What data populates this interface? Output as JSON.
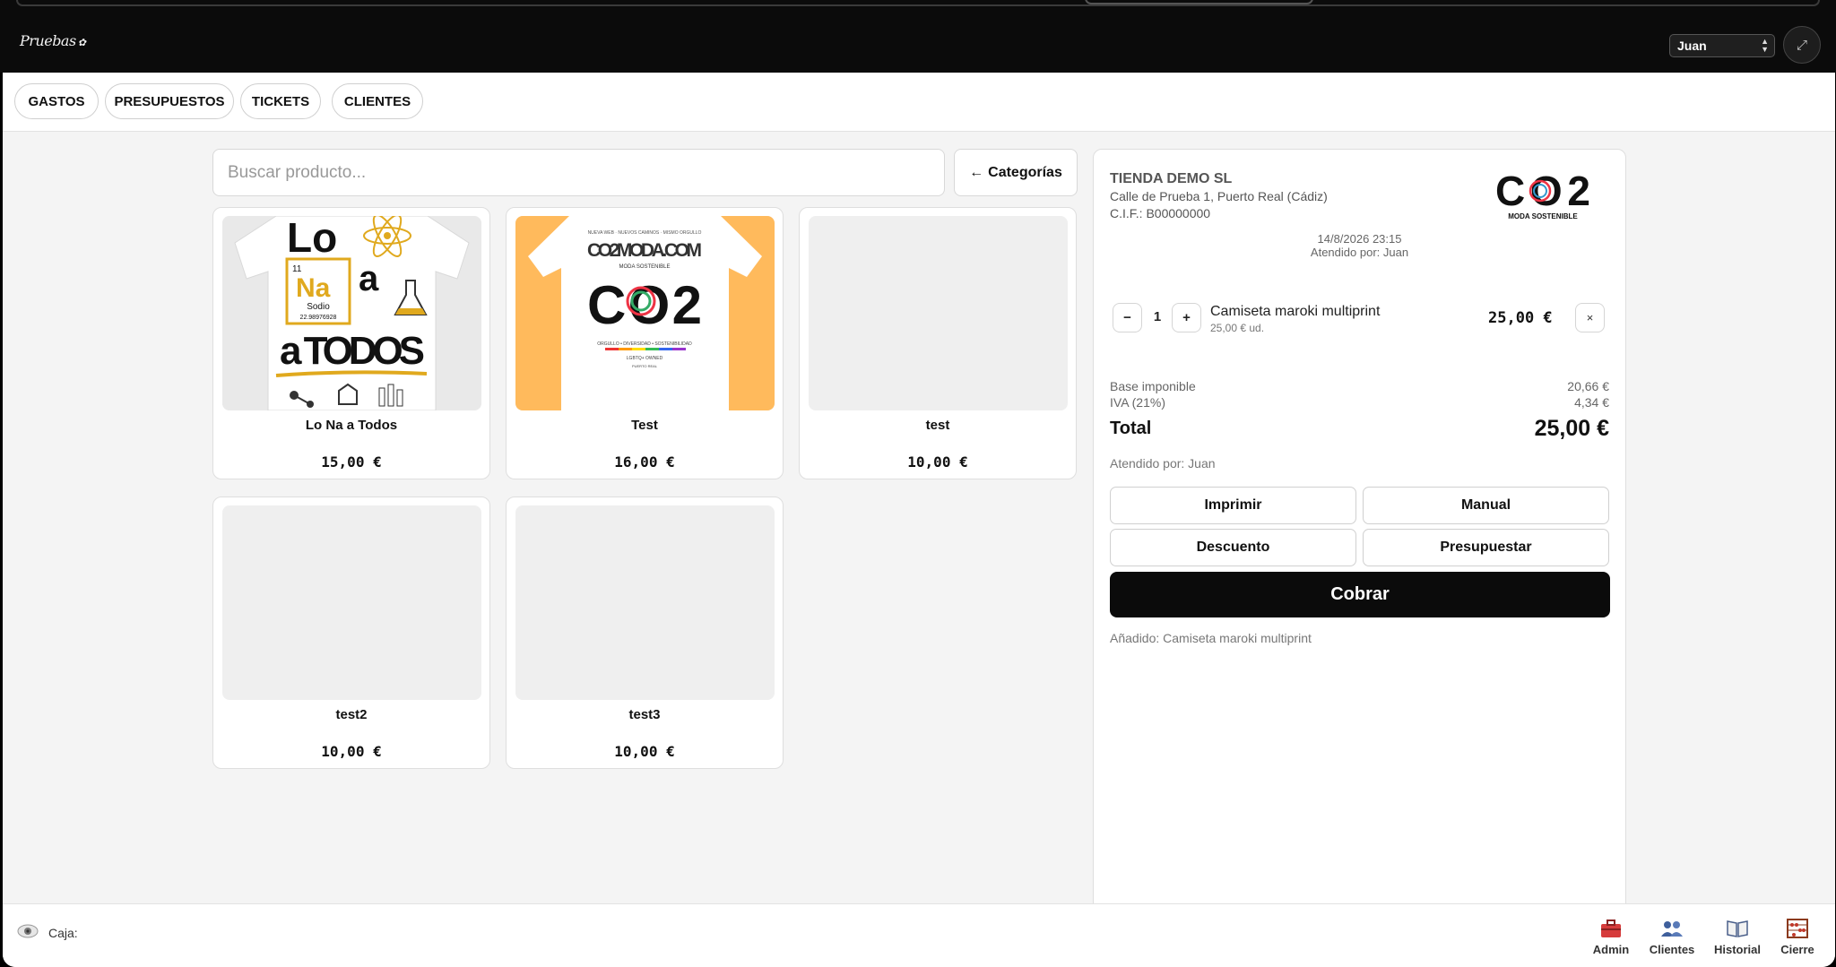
{
  "header": {
    "logo_text": "Pruebas",
    "user_selected": "Juan"
  },
  "nav": [
    "GASTOS",
    "PRESUPUESTOS",
    "TICKETS",
    "CLIENTES"
  ],
  "search": {
    "placeholder": "Buscar producto..."
  },
  "categories_button": {
    "arrow": "←",
    "label": "Categorías"
  },
  "products": [
    {
      "name": "Lo Na a Todos",
      "price": "15,00 €",
      "art": {
        "line1": "Lo",
        "element_number": "11",
        "symbol": "Na",
        "element_name": "Sodio",
        "element_mass": "22.98976928",
        "line2": "a",
        "line3": "a TODOS"
      }
    },
    {
      "name": "Test",
      "price": "16,00 €",
      "art": {
        "top_small": "NUEVA WEB · NUEVOS CAMINOS · MISMO ORGULLO",
        "site": "CO2MODA.COM",
        "sub": "MODA SOSTENIBLE",
        "big": "CO2",
        "bottom": "ORGULLO • DIVERSIDAD • SOSTENIBILIDAD",
        "bottom2": "LGBTQ+ OWNED",
        "place": "PUERTO REAL"
      }
    },
    {
      "name": "test",
      "price": "10,00 €"
    },
    {
      "name": "test2",
      "price": "10,00 €"
    },
    {
      "name": "test3",
      "price": "10,00 €"
    }
  ],
  "ticket": {
    "store_name": "TIENDA DEMO SL",
    "address": "Calle de Prueba 1, Puerto Real (Cádiz)",
    "cif": "C.I.F.: B00000000",
    "logo_big": "CO2",
    "logo_sub": "MODA SOSTENIBLE",
    "datetime": "14/8/2026 23:15",
    "attended": "Atendido por: Juan",
    "line": {
      "qty": "1",
      "minus": "−",
      "plus": "+",
      "name": "Camiseta maroki multiprint",
      "unit": "25,00 € ud.",
      "price": "25,00 €",
      "remove": "×"
    },
    "base_label": "Base imponible",
    "base_value": "20,66 €",
    "iva_label": "IVA (21%)",
    "iva_value": "4,34 €",
    "total_label": "Total",
    "total_value": "25,00 €",
    "attended_bottom": "Atendido por: Juan",
    "buttons": {
      "print": "Imprimir",
      "manual": "Manual",
      "discount": "Descuento",
      "quote": "Presupuestar",
      "charge": "Cobrar"
    },
    "added_msg": "Añadido: Camiseta maroki multiprint"
  },
  "footer": {
    "caja_label": "Caja:",
    "items": [
      "Admin",
      "Clientes",
      "Historial",
      "Cierre"
    ]
  },
  "colors": {
    "header_bg": "#0b0b0b",
    "charge_bg": "#0b0b0b",
    "card_orange": "#ffba5c",
    "accent_gold": "#e0a91e",
    "admin_red": "#d63b3b",
    "clientes_blue": "#3e5f9c"
  }
}
